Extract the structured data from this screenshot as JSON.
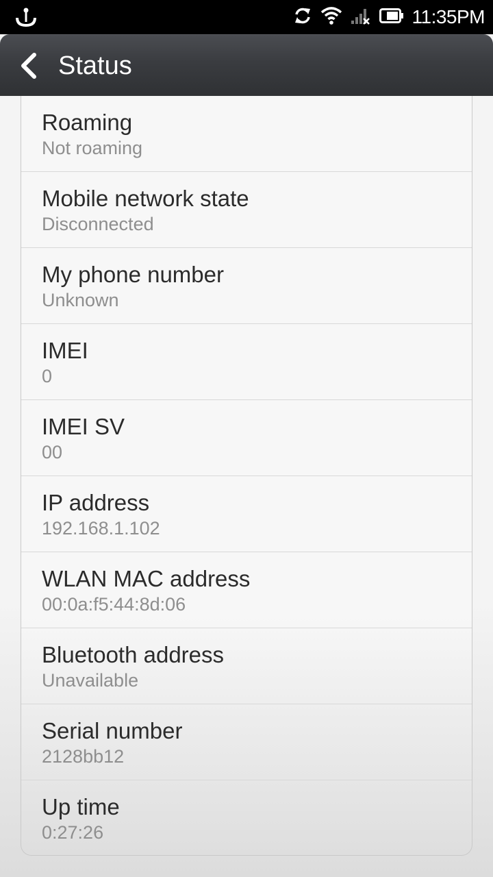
{
  "status_bar": {
    "time": "11:35PM",
    "icons": [
      "usb-anchor-icon",
      "sync-icon",
      "wifi-icon",
      "signal-no-service-icon",
      "battery-icon"
    ]
  },
  "header": {
    "title": "Status",
    "back_icon": "chevron-left-icon"
  },
  "items": [
    {
      "title": "Roaming",
      "value": "Not roaming"
    },
    {
      "title": "Mobile network state",
      "value": "Disconnected"
    },
    {
      "title": "My phone number",
      "value": "Unknown"
    },
    {
      "title": "IMEI",
      "value": "0"
    },
    {
      "title": "IMEI SV",
      "value": "00"
    },
    {
      "title": "IP address",
      "value": "192.168.1.102"
    },
    {
      "title": "WLAN MAC address",
      "value": "00:0a:f5:44:8d:06"
    },
    {
      "title": "Bluetooth address",
      "value": "Unavailable"
    },
    {
      "title": "Serial number",
      "value": "2128bb12"
    },
    {
      "title": "Up time",
      "value": "0:27:26"
    }
  ]
}
